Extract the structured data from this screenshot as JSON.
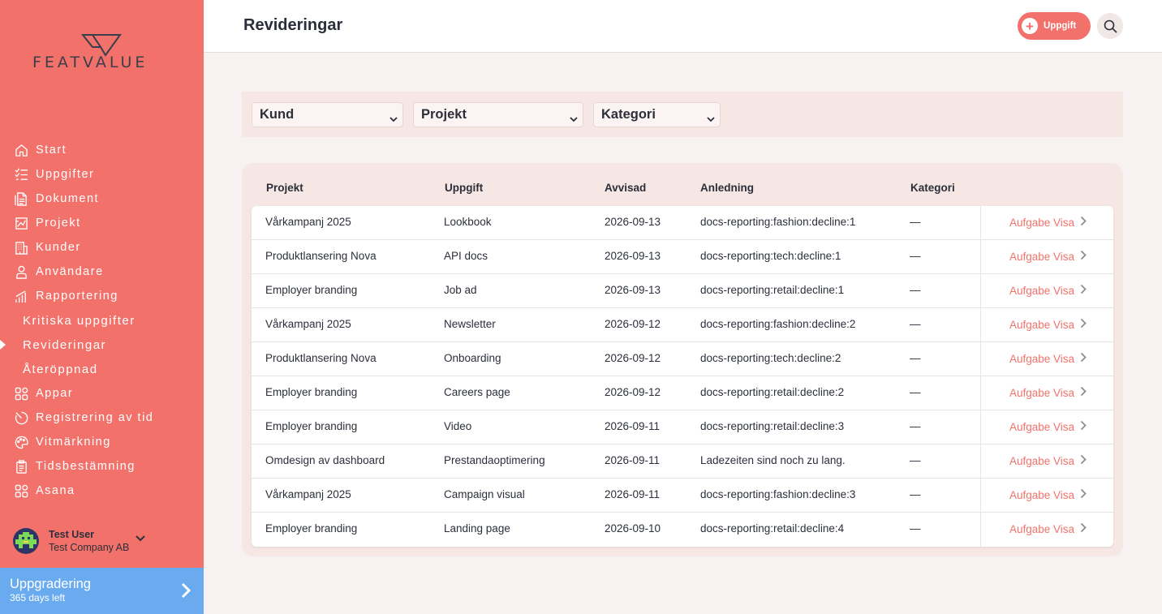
{
  "brand": {
    "logo_text": "FEATVALUE"
  },
  "sidebar": {
    "items": [
      {
        "label": "Start",
        "icon": "home-icon"
      },
      {
        "label": "Uppgifter",
        "icon": "checklist-icon"
      },
      {
        "label": "Dokument",
        "icon": "document-icon"
      },
      {
        "label": "Projekt",
        "icon": "project-icon"
      },
      {
        "label": "Kunder",
        "icon": "building-icon"
      },
      {
        "label": "Användare",
        "icon": "user-icon"
      },
      {
        "label": "Rapportering",
        "icon": "bar-chart-icon"
      },
      {
        "label": "Kritiska uppgifter",
        "sub": true
      },
      {
        "label": "Revideringar",
        "sub": true,
        "active": true
      },
      {
        "label": "Återöppnad",
        "sub": true
      },
      {
        "label": "Appar",
        "icon": "apps-icon"
      },
      {
        "label": "Registrering av tid",
        "icon": "timer-icon"
      },
      {
        "label": "Vitmärkning",
        "icon": "palette-icon"
      },
      {
        "label": "Tidsbestämning",
        "icon": "clipboard-icon"
      },
      {
        "label": "Asana",
        "icon": "apps-icon"
      }
    ],
    "user": {
      "name": "Test User",
      "company": "Test Company AB"
    },
    "upgrade": {
      "title": "Uppgradering",
      "subtitle": "365 days left"
    }
  },
  "header": {
    "title": "Revideringar",
    "add_task_label": "Uppgift"
  },
  "filters": {
    "customer": "Kund",
    "project": "Projekt",
    "category": "Kategori"
  },
  "table": {
    "columns": [
      "Projekt",
      "Uppgift",
      "Avvisad",
      "Anledning",
      "Kategori"
    ],
    "action_label": "Aufgabe Visa",
    "rows": [
      {
        "project": "Vårkampanj 2025",
        "task": "Lookbook",
        "date": "2026-09-13",
        "reason": "docs-reporting:fashion:decline:1",
        "category": "—"
      },
      {
        "project": "Produktlansering Nova",
        "task": "API docs",
        "date": "2026-09-13",
        "reason": "docs-reporting:tech:decline:1",
        "category": "—"
      },
      {
        "project": "Employer branding",
        "task": "Job ad",
        "date": "2026-09-13",
        "reason": "docs-reporting:retail:decline:1",
        "category": "—"
      },
      {
        "project": "Vårkampanj 2025",
        "task": "Newsletter",
        "date": "2026-09-12",
        "reason": "docs-reporting:fashion:decline:2",
        "category": "—"
      },
      {
        "project": "Produktlansering Nova",
        "task": "Onboarding",
        "date": "2026-09-12",
        "reason": "docs-reporting:tech:decline:2",
        "category": "—"
      },
      {
        "project": "Employer branding",
        "task": "Careers page",
        "date": "2026-09-12",
        "reason": "docs-reporting:retail:decline:2",
        "category": "—"
      },
      {
        "project": "Employer branding",
        "task": "Video",
        "date": "2026-09-11",
        "reason": "docs-reporting:retail:decline:3",
        "category": "—"
      },
      {
        "project": "Omdesign av dashboard",
        "task": "Prestandaoptimering",
        "date": "2026-09-11",
        "reason": "Ladezeiten sind noch zu lang.",
        "category": "—"
      },
      {
        "project": "Vårkampanj 2025",
        "task": "Campaign visual",
        "date": "2026-09-11",
        "reason": "docs-reporting:fashion:decline:3",
        "category": "—"
      },
      {
        "project": "Employer branding",
        "task": "Landing page",
        "date": "2026-09-10",
        "reason": "docs-reporting:retail:decline:4",
        "category": "—"
      }
    ]
  },
  "colors": {
    "accent": "#f2726b",
    "upgrade": "#6aabf0",
    "text": "#2b2f3a"
  }
}
